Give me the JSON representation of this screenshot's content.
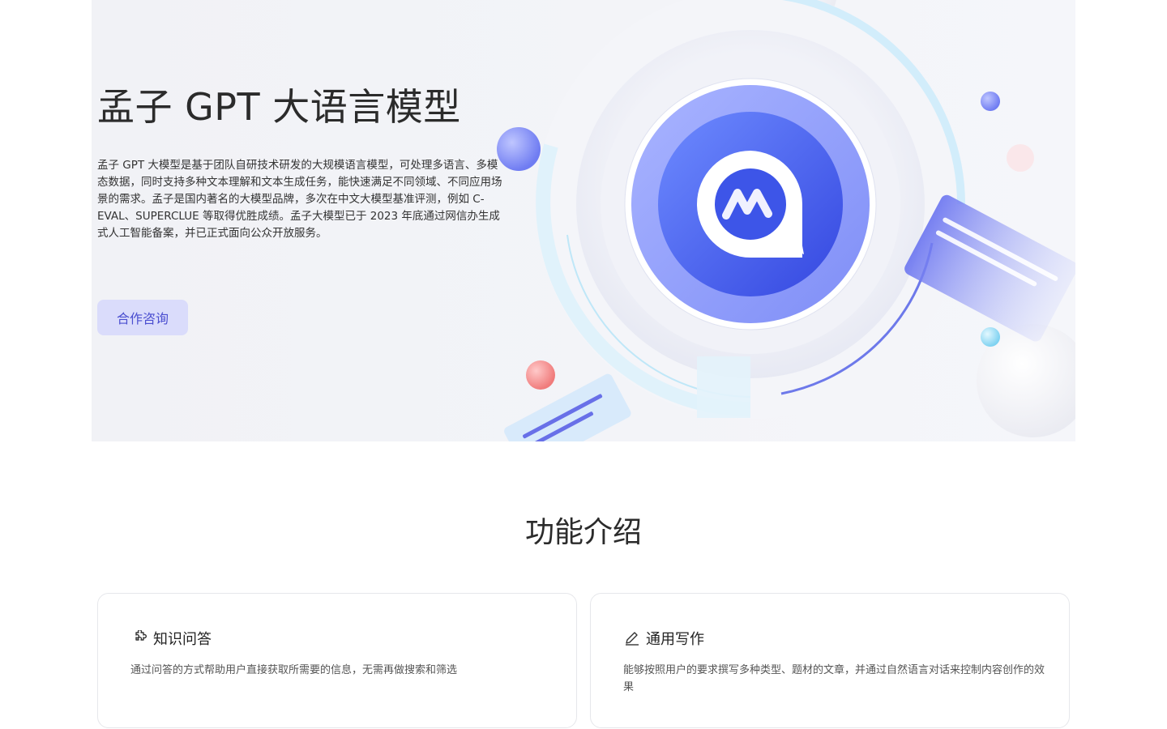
{
  "hero": {
    "title": "孟子 GPT 大语言模型",
    "description": "孟子 GPT 大模型是基于团队自研技术研发的大规模语言模型，可处理多语言、多模态数据，同时支持多种文本理解和文本生成任务，能快速满足不同领域、不同应用场景的需求。孟子是国内著名的大模型品牌，多次在中文大模型基准评测，例如 C-EVAL、SUPERCLUE 等取得优胜成绩。孟子大模型已于 2023 年底通过网信办生成式人工智能备案，并已正式面向公众开放服务。",
    "button_label": "合作咨询"
  },
  "features": {
    "title": "功能介绍",
    "cards": [
      {
        "icon": "puzzle-icon",
        "title": "知识问答",
        "description": "通过问答的方式帮助用户直接获取所需要的信息，无需再做搜索和筛选"
      },
      {
        "icon": "writing-icon",
        "title": "通用写作",
        "description": "能够按照用户的要求撰写多种类型、题材的文章，并通过自然语言对话来控制内容创作的效果"
      }
    ]
  },
  "colors": {
    "accent": "#4b4fd0",
    "button_bg": "#dadcfb",
    "logo_blue": "#3d55e8",
    "hero_bg": "#f2f3f7"
  }
}
